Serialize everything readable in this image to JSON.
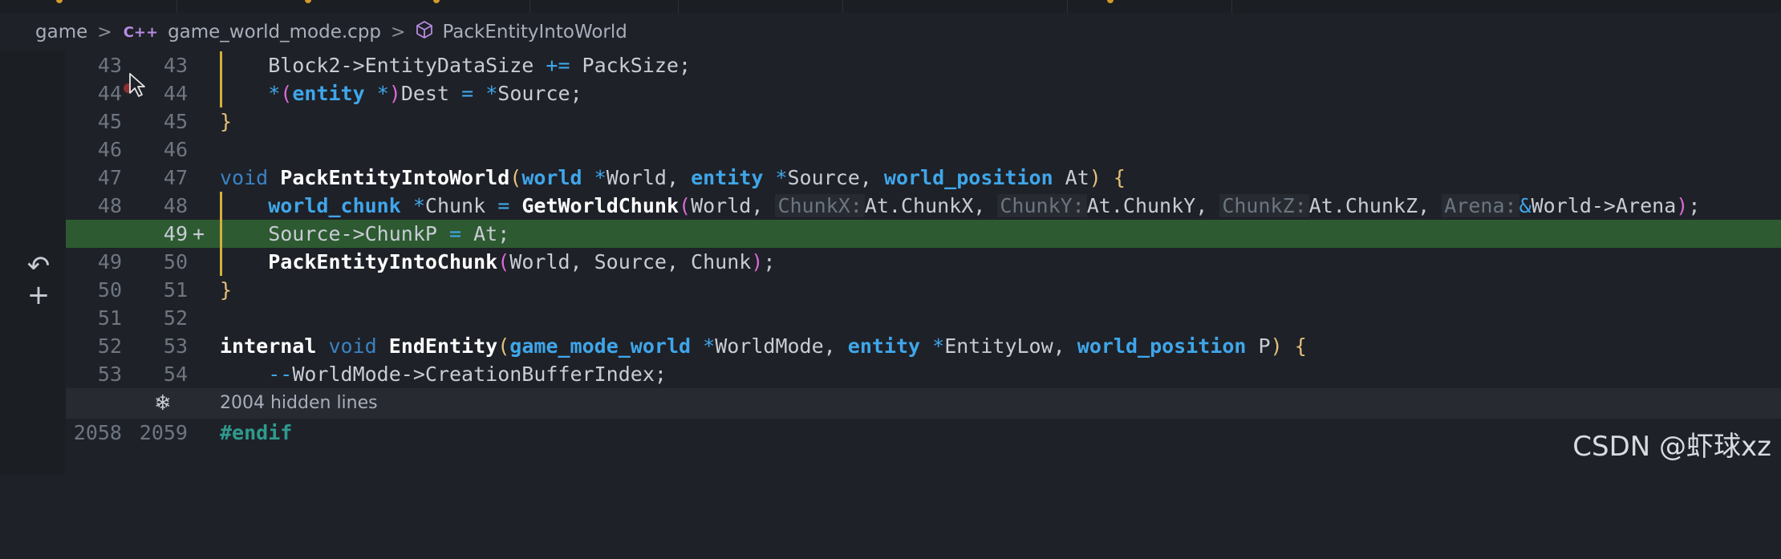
{
  "breadcrumb": {
    "root": "game",
    "file": "game_world_mode.cpp",
    "file_icon_text": "C++",
    "symbol": "PackEntityIntoWorld",
    "separator": ">"
  },
  "gutter": {
    "revert_icon": "↶",
    "add_icon": "+"
  },
  "lines": [
    {
      "old": "43",
      "new": "43"
    },
    {
      "old": "44",
      "new": "44"
    },
    {
      "old": "45",
      "new": "45"
    },
    {
      "old": "46",
      "new": "46"
    },
    {
      "old": "47",
      "new": "47"
    },
    {
      "old": "48",
      "new": "48"
    },
    {
      "old": "",
      "new": "49",
      "marker": "+"
    },
    {
      "old": "49",
      "new": "50"
    },
    {
      "old": "50",
      "new": "51"
    },
    {
      "old": "51",
      "new": "52"
    },
    {
      "old": "52",
      "new": "53"
    },
    {
      "old": "53",
      "new": "54"
    },
    {
      "old": "2058",
      "new": "2059"
    }
  ],
  "code": {
    "l43": {
      "a": "    Block2->EntityDataSize ",
      "op": "+=",
      "b": " PackSize;"
    },
    "l44": {
      "a": "    ",
      "star": "*",
      "p1": "(",
      "t": "entity",
      "star2": " *",
      "p2": ")",
      "b": "Dest ",
      "eq": "=",
      "star3": " *",
      "c": "Source;"
    },
    "l45": {
      "close": "}"
    },
    "l47": {
      "void": "void",
      "fn": "PackEntityIntoWorld",
      "p1": "(",
      "t1": "world",
      "s1": " *",
      "v1": "World, ",
      "t2": "entity",
      "s2": " *",
      "v2": "Source, ",
      "t3": "world_position",
      "v3": " At",
      "p2": ")",
      "brace": "{"
    },
    "l48": {
      "t": "world_chunk",
      "s": " *",
      "v": "Chunk ",
      "eq": "=",
      "fn": "GetWorldChunk",
      "p1": "(",
      "a1": "World, ",
      "h1": "ChunkX:",
      "a2": "At.ChunkX, ",
      "h2": "ChunkY:",
      "a3": "At.ChunkY, ",
      "h3": "ChunkZ:",
      "a4": "At.ChunkZ, ",
      "h4": "Arena:",
      "amp": "&",
      "a5": "World->Arena",
      "p2": ")",
      "end": ";"
    },
    "l49": {
      "a": "    Source->ChunkP ",
      "eq": "=",
      "b": " At;"
    },
    "l50": {
      "fn": "PackEntityIntoChunk",
      "p1": "(",
      "a": "World, Source, Chunk",
      "p2": ")",
      "end": ";"
    },
    "l51": {
      "close": "}"
    },
    "l53": {
      "internal": "internal",
      "void": "void",
      "fn": "EndEntity",
      "p1": "(",
      "t1": "game_mode_world",
      "s1": " *",
      "v1": "WorldMode, ",
      "t2": "entity",
      "s2": " *",
      "v2": "EntityLow, ",
      "t3": "world_position",
      "v3": " P",
      "p2": ")",
      "brace": "{"
    },
    "l54": {
      "op": "--",
      "b": "WorldMode->CreationBufferIndex;"
    },
    "l2059": {
      "pp": "#endif"
    }
  },
  "hidden": {
    "icon": "❄",
    "text": "2004 hidden lines"
  },
  "watermark": "CSDN @虾球xz",
  "colors": {
    "background": "#1e2127",
    "keyword": "#3fa6ea",
    "added_line": "#2d5a31",
    "modified_bar": "#d4b03a",
    "bracket_yellow": "#e5c07b",
    "bracket_magenta": "#d96ad6"
  }
}
